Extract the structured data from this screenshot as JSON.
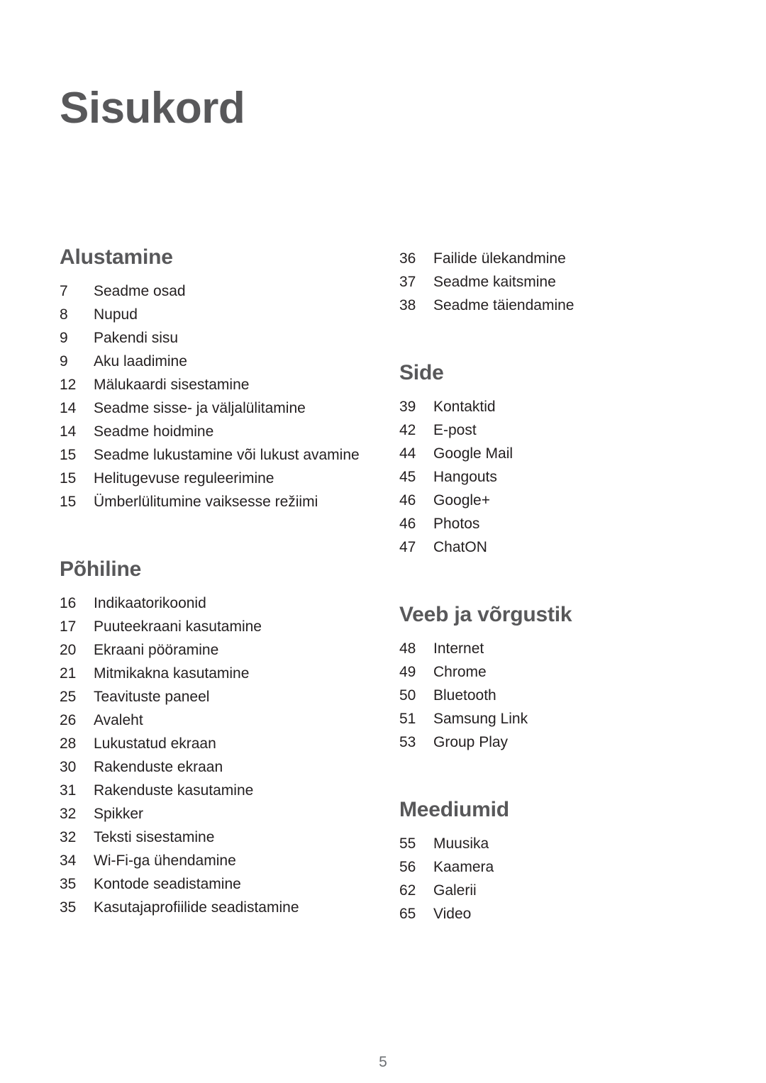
{
  "document": {
    "title": "Sisukord",
    "footer_page_number": "5"
  },
  "colors": {
    "heading": "#58585a",
    "body_text": "#231f20",
    "page_number_footer": "#6d7074",
    "background": "#ffffff"
  },
  "columns": {
    "left": [
      {
        "heading": "Alustamine",
        "entries": [
          {
            "page": "7",
            "title": "Seadme osad"
          },
          {
            "page": "8",
            "title": "Nupud"
          },
          {
            "page": "9",
            "title": "Pakendi sisu"
          },
          {
            "page": "9",
            "title": "Aku laadimine"
          },
          {
            "page": "12",
            "title": "Mälukaardi sisestamine"
          },
          {
            "page": "14",
            "title": "Seadme sisse- ja väljalülitamine"
          },
          {
            "page": "14",
            "title": "Seadme hoidmine"
          },
          {
            "page": "15",
            "title": "Seadme lukustamine või lukust avamine"
          },
          {
            "page": "15",
            "title": "Helitugevuse reguleerimine"
          },
          {
            "page": "15",
            "title": "Ümberlülitumine vaiksesse režiimi"
          }
        ]
      },
      {
        "heading": "Põhiline",
        "entries": [
          {
            "page": "16",
            "title": "Indikaatorikoonid"
          },
          {
            "page": "17",
            "title": "Puuteekraani kasutamine"
          },
          {
            "page": "20",
            "title": "Ekraani pööramine"
          },
          {
            "page": "21",
            "title": "Mitmikakna kasutamine"
          },
          {
            "page": "25",
            "title": "Teavituste paneel"
          },
          {
            "page": "26",
            "title": "Avaleht"
          },
          {
            "page": "28",
            "title": "Lukustatud ekraan"
          },
          {
            "page": "30",
            "title": "Rakenduste ekraan"
          },
          {
            "page": "31",
            "title": "Rakenduste kasutamine"
          },
          {
            "page": "32",
            "title": "Spikker"
          },
          {
            "page": "32",
            "title": "Teksti sisestamine"
          },
          {
            "page": "34",
            "title": "Wi-Fi-ga ühendamine"
          },
          {
            "page": "35",
            "title": "Kontode seadistamine"
          },
          {
            "page": "35",
            "title": "Kasutajaprofiilide seadistamine"
          }
        ]
      }
    ],
    "right": [
      {
        "heading": "",
        "entries": [
          {
            "page": "36",
            "title": "Failide ülekandmine"
          },
          {
            "page": "37",
            "title": "Seadme kaitsmine"
          },
          {
            "page": "38",
            "title": "Seadme täiendamine"
          }
        ]
      },
      {
        "heading": "Side",
        "entries": [
          {
            "page": "39",
            "title": "Kontaktid"
          },
          {
            "page": "42",
            "title": "E-post"
          },
          {
            "page": "44",
            "title": "Google Mail"
          },
          {
            "page": "45",
            "title": "Hangouts"
          },
          {
            "page": "46",
            "title": "Google+"
          },
          {
            "page": "46",
            "title": "Photos"
          },
          {
            "page": "47",
            "title": "ChatON"
          }
        ]
      },
      {
        "heading": "Veeb ja võrgustik",
        "entries": [
          {
            "page": "48",
            "title": "Internet"
          },
          {
            "page": "49",
            "title": "Chrome"
          },
          {
            "page": "50",
            "title": "Bluetooth"
          },
          {
            "page": "51",
            "title": "Samsung Link"
          },
          {
            "page": "53",
            "title": "Group Play"
          }
        ]
      },
      {
        "heading": "Meediumid",
        "entries": [
          {
            "page": "55",
            "title": "Muusika"
          },
          {
            "page": "56",
            "title": "Kaamera"
          },
          {
            "page": "62",
            "title": "Galerii"
          },
          {
            "page": "65",
            "title": "Video"
          }
        ]
      }
    ]
  }
}
